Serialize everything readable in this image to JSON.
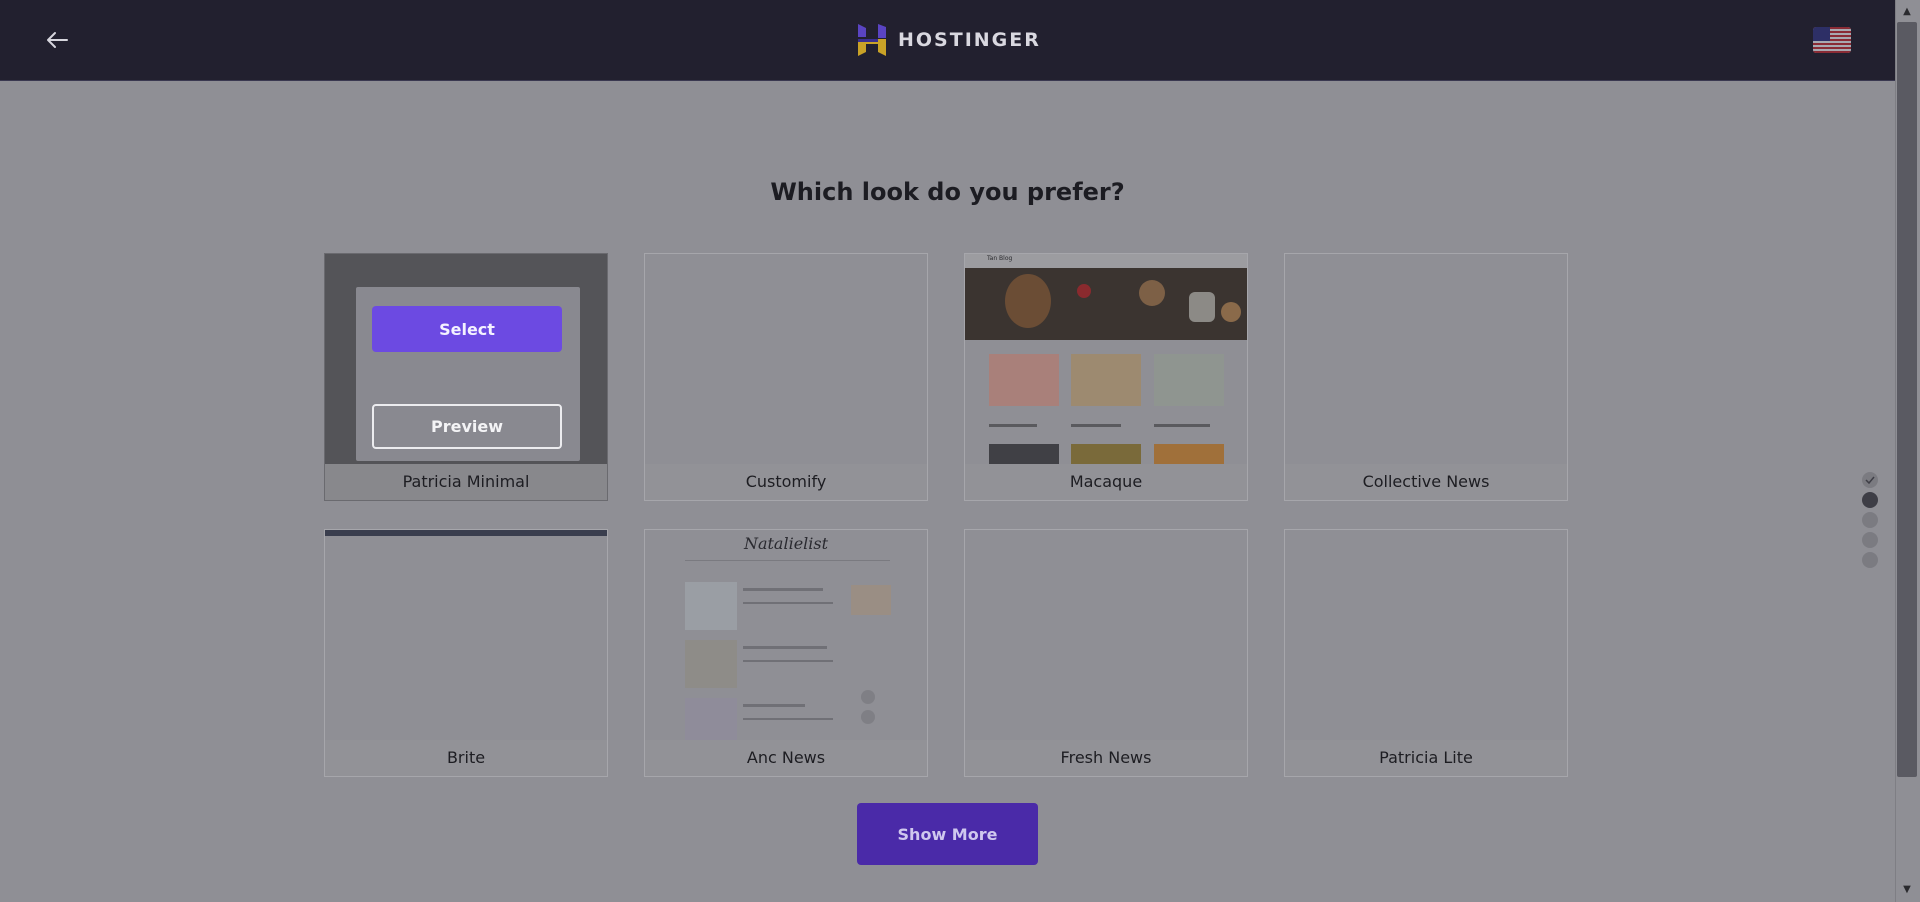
{
  "header": {
    "brand": "HOSTINGER",
    "back_icon": "arrow-left-icon",
    "language_icon": "us-flag-icon"
  },
  "main": {
    "heading": "Which look do you prefer?",
    "themes": [
      {
        "name": "Patricia Minimal"
      },
      {
        "name": "Customify"
      },
      {
        "name": "Macaque"
      },
      {
        "name": "Collective News"
      },
      {
        "name": "Brite"
      },
      {
        "name": "Anc News"
      },
      {
        "name": "Fresh News"
      },
      {
        "name": "Patricia Lite"
      }
    ],
    "hover_actions": {
      "select_label": "Select",
      "preview_label": "Preview"
    },
    "show_more_label": "Show More"
  },
  "thumbnails": {
    "macaque_blog_title": "Tan Blog",
    "natalielist_title": "Natalielist"
  },
  "steps": {
    "total": 5,
    "completed": 1,
    "current": 2
  },
  "colors": {
    "header_bg": "#22202f",
    "accent": "#6c4ae2",
    "show_more_bg": "#4a2aa8"
  }
}
